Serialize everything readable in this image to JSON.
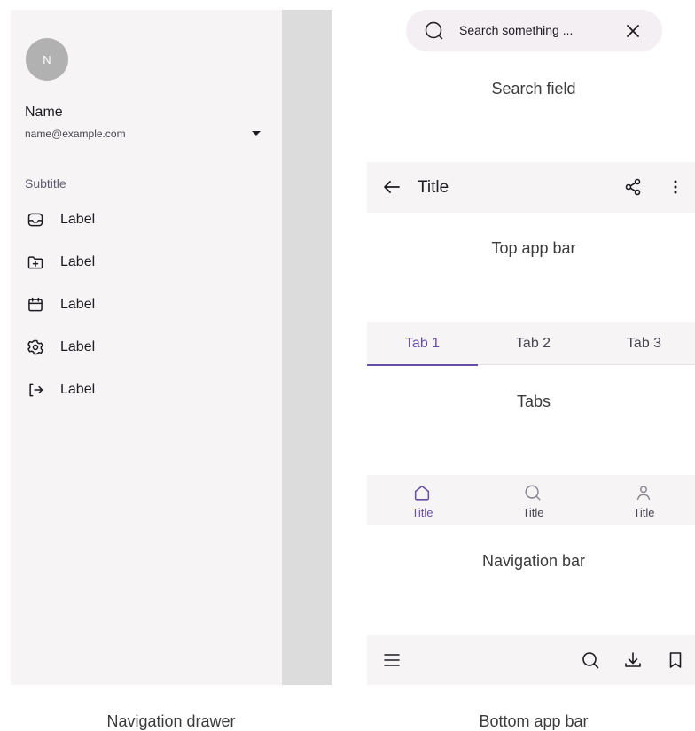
{
  "drawer": {
    "avatar_initial": "N",
    "user_name": "Name",
    "user_email": "name@example.com",
    "subtitle": "Subtitle",
    "items": [
      {
        "icon": "inbox-icon",
        "label": "Label"
      },
      {
        "icon": "folder-add-icon",
        "label": "Label"
      },
      {
        "icon": "calendar-icon",
        "label": "Label"
      },
      {
        "icon": "gear-icon",
        "label": "Label"
      },
      {
        "icon": "logout-icon",
        "label": "Label"
      }
    ]
  },
  "search": {
    "placeholder": "Search something ...",
    "value": ""
  },
  "top_app_bar": {
    "title": "Title"
  },
  "tabs": {
    "items": [
      "Tab 1",
      "Tab 2",
      "Tab 3"
    ],
    "active_index": 0
  },
  "navigation_bar": {
    "items": [
      {
        "icon": "home-icon",
        "label": "Title"
      },
      {
        "icon": "search-icon",
        "label": "Title"
      },
      {
        "icon": "person-icon",
        "label": "Title"
      }
    ],
    "active_index": 0
  },
  "captions": {
    "search_field": "Search field",
    "top_app_bar": "Top app bar",
    "tabs": "Tabs",
    "navigation_bar": "Navigation bar",
    "bottom_app_bar": "Bottom app bar",
    "navigation_drawer": "Navigation drawer"
  },
  "colors": {
    "primary": "#6750a4",
    "surface": "#f7f4f6",
    "scrim": "#dcdcdc",
    "avatar": "#b1b1b1"
  }
}
